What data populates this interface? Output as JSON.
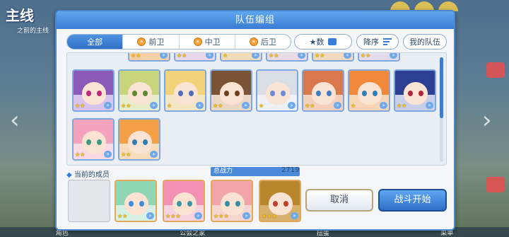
{
  "background": {
    "title": "主线",
    "subtitle": "之前的主线",
    "bottom_items": [
      "角色",
      "",
      "",
      "公会之家",
      "扭蛋",
      "菜单"
    ]
  },
  "dialog": {
    "title": "队伍编组",
    "tabs": [
      {
        "label": "全部",
        "active": true
      },
      {
        "label": "前卫",
        "active": false
      },
      {
        "label": "中卫",
        "active": false
      },
      {
        "label": "后卫",
        "active": false
      }
    ],
    "sort_key_label": "★数",
    "sort_order_label": "降序",
    "my_team_label": "我的队伍",
    "members_label": "当前的成员",
    "total_power_label": "总战力",
    "total_power_value": "2719",
    "cancel_label": "取消",
    "start_label": "战斗开始",
    "scroll_fraction": 0.58
  },
  "roster_partial_row": [
    {
      "stars": "★★",
      "hair": "#f0a46a",
      "bg": "#f6d0a8"
    },
    {
      "stars": "★★",
      "hair": "#f4c6c8",
      "bg": "#e7d7ea"
    },
    {
      "stars": "★",
      "hair": "#f1c986",
      "bg": "#f0ddb8"
    },
    {
      "stars": "★★",
      "hair": "#e9b6c7",
      "bg": "#e8dbe6"
    },
    {
      "stars": "★★",
      "hair": "#d9a279",
      "bg": "#f3d9bf"
    },
    {
      "stars": "★★",
      "hair": "#c0a8d6",
      "bg": "#e2dced"
    }
  ],
  "roster": [
    {
      "name": "purple-hair-red-glasses",
      "stars": "★★",
      "hair": "#8b59b8",
      "bg": "#d9c4ee",
      "eye": "#c0267d"
    },
    {
      "name": "blonde-green-cap",
      "stars": "★★",
      "hair": "#c9d57a",
      "bg": "#e7ecc9",
      "eye": "#5c8a2d"
    },
    {
      "name": "blonde-ribbon",
      "stars": "★",
      "hair": "#f2d37a",
      "bg": "#f2e6c4",
      "eye": "#4f6fb8"
    },
    {
      "name": "brown-hair-headband",
      "stars": "★★",
      "hair": "#7a5236",
      "bg": "#ead8c4",
      "eye": "#6a4020"
    },
    {
      "name": "silver-hair",
      "stars": "★",
      "hair": "#d9dde4",
      "bg": "#edf0f4",
      "eye": "#6b8bd9"
    },
    {
      "name": "orange-short-hair",
      "stars": "★★",
      "hair": "#d9784a",
      "bg": "#f2d0bb",
      "eye": "#3f7ec2"
    },
    {
      "name": "orange-hair-wink",
      "stars": "★",
      "hair": "#f08a3a",
      "bg": "#f6d6b6",
      "eye": "#2f7fb0"
    },
    {
      "name": "navy-hair-red-eyes",
      "stars": "★★",
      "hair": "#2d3f92",
      "bg": "#c8cfe9",
      "eye": "#b02a3c"
    },
    {
      "name": "pink-long-hair",
      "stars": "★★",
      "hair": "#f3a3bd",
      "bg": "#f7dae3",
      "eye": "#3d9a86"
    },
    {
      "name": "orange-hair-smile",
      "stars": "★★",
      "hair": "#f3a046",
      "bg": "#f7ddbc",
      "eye": "#2d7fb5"
    }
  ],
  "team": [
    {
      "name": "mint-hair-flower",
      "stars": "★★",
      "hair": "#8fd6b4",
      "bg": "#d6f0e4",
      "eye": "#3f8fd6"
    },
    {
      "name": "pink-hair-bow",
      "stars": "★★★",
      "hair": "#f38fb3",
      "bg": "#f7d3df",
      "eye": "#3d95a8"
    },
    {
      "name": "pink-hair-elf",
      "stars": "★★★",
      "hair": "#f2a5a8",
      "bg": "#f5d6cf",
      "eye": "#3a8fa3"
    },
    {
      "name": "gold-hair-devil",
      "stars": "★★★",
      "hair": "#b8862d",
      "bg": "#d7b06c",
      "eye": "#c13f2b"
    }
  ]
}
